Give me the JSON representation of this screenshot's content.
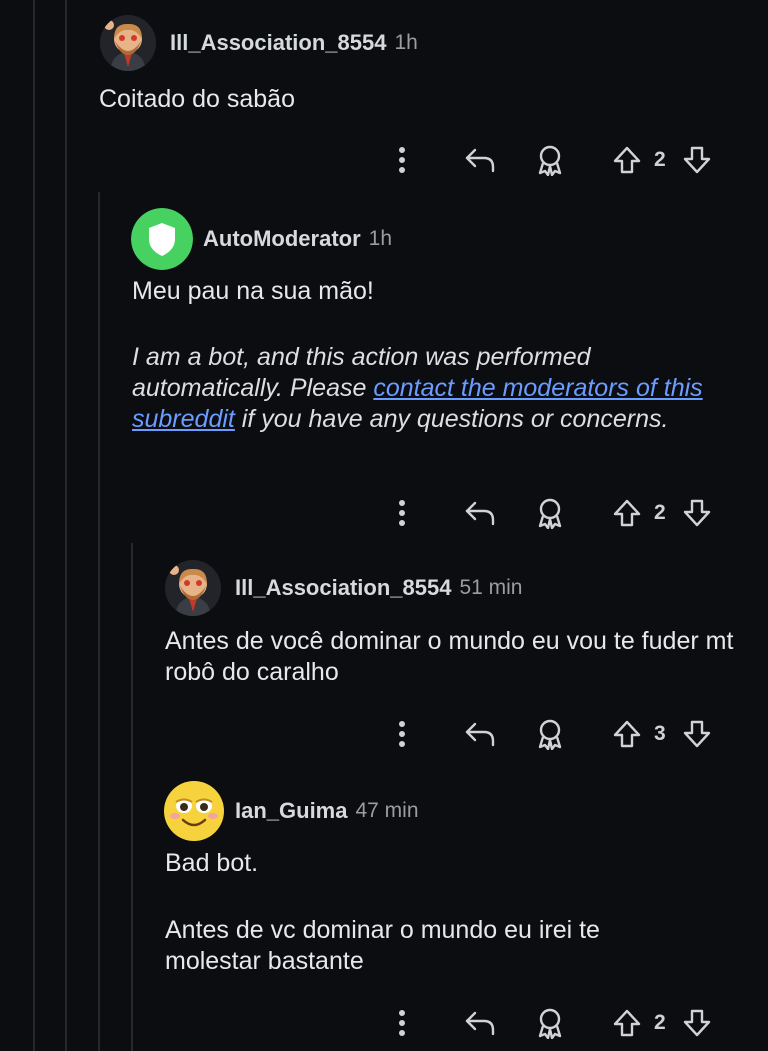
{
  "colors": {
    "background": "#0c0d10",
    "link": "#6b9cff",
    "thread_line": "#26282c",
    "automod_green": "#46d160"
  },
  "comments": [
    {
      "username": "Ill_Association_8554",
      "time": "1h",
      "avatar": "snoo-bearded-man-avatar",
      "body": "Coitado do sabão",
      "votes": "2"
    },
    {
      "username": "AutoModerator",
      "time": "1h",
      "avatar": "shield-avatar",
      "body": "Meu pau na sua mão!",
      "bot_note_before": "I am a bot, and this action was performed automatically. Please ",
      "bot_note_link": "contact the moderators of this subreddit",
      "bot_note_after": " if you have any questions or concerns.",
      "votes": "2"
    },
    {
      "username": "Ill_Association_8554",
      "time": "51 min",
      "avatar": "snoo-bearded-man-avatar",
      "body": "Antes de você dominar o mundo eu vou te fuder mt robô do caralho",
      "votes": "3"
    },
    {
      "username": "Ian_Guima",
      "time": "47 min",
      "avatar": "smiley-face-avatar",
      "body_line1": "Bad bot.",
      "body_line2": "Antes de vc dominar o mundo eu irei te molestar bastante",
      "votes": "2"
    }
  ],
  "action_icons": [
    "more-vertical-icon",
    "reply-icon",
    "award-icon",
    "upvote-icon",
    "downvote-icon"
  ]
}
